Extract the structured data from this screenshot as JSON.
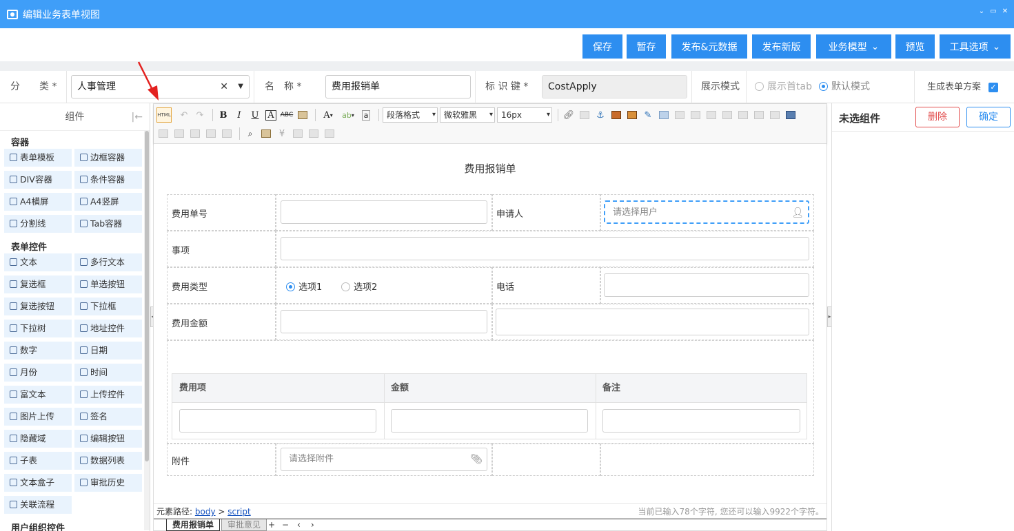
{
  "window": {
    "title": "编辑业务表单视图"
  },
  "actions": [
    {
      "label": "保存"
    },
    {
      "label": "暂存"
    },
    {
      "label": "发布&元数据"
    },
    {
      "label": "发布新版"
    },
    {
      "label": "业务模型"
    },
    {
      "label": "预览"
    },
    {
      "label": "工具选项"
    }
  ],
  "form_meta": {
    "category_label": "分　　类 *",
    "category_value": "人事管理",
    "name_label": "名　称 *",
    "name_value": "费用报销单",
    "key_label": "标 识 键 *",
    "key_value": "CostApply",
    "display_mode_label": "展示模式",
    "mode_options": [
      "展示首tab",
      "默认模式"
    ],
    "generate_label": "生成表单方案"
  },
  "left_panel": {
    "title": "组件",
    "sections": [
      {
        "name": "容器",
        "items": [
          "表单模板",
          "边框容器",
          "DIV容器",
          "条件容器",
          "A4横屏",
          "A4竖屏",
          "分割线",
          "Tab容器"
        ]
      },
      {
        "name": "表单控件",
        "items": [
          "文本",
          "多行文本",
          "复选框",
          "单选按钮",
          "复选按钮",
          "下拉框",
          "下拉树",
          "地址控件",
          "数字",
          "日期",
          "月份",
          "时间",
          "富文本",
          "上传控件",
          "图片上传",
          "签名",
          "隐藏域",
          "编辑按钮",
          "子表",
          "数据列表",
          "文本盒子",
          "审批历史",
          "关联流程"
        ]
      },
      {
        "name": "用户组织控件",
        "items": []
      }
    ]
  },
  "toolbar": {
    "html_label": "HTML",
    "paragraph": "段落格式",
    "font": "微软雅黑",
    "size": "16px"
  },
  "form": {
    "title": "费用报销单",
    "fields": {
      "fee_no": "费用单号",
      "applicant": "申请人",
      "applicant_placeholder": "请选择用户",
      "item": "事项",
      "fee_type": "费用类型",
      "option1": "选项1",
      "option2": "选项2",
      "phone": "电话",
      "amount": "费用金额",
      "attachment": "附件",
      "attachment_placeholder": "请选择附件"
    },
    "subtable": {
      "columns": [
        "费用项",
        "金额",
        "备注"
      ]
    }
  },
  "statusbar": {
    "path_label": "元素路径:",
    "path": [
      "body",
      "script"
    ],
    "count_text": "当前已输入78个字符, 您还可以输入9922个字符。"
  },
  "tabs": [
    "费用报销单",
    "审批意见"
  ],
  "tab_controls": [
    "+",
    "−",
    "‹",
    "›"
  ],
  "right_panel": {
    "title": "未选组件",
    "delete": "删除",
    "confirm": "确定"
  },
  "colors": {
    "primary": "#2d8ef0",
    "titlebar": "#3f9ef8",
    "danger": "#e24b4b",
    "annotation_arrow": "#e3211f"
  }
}
